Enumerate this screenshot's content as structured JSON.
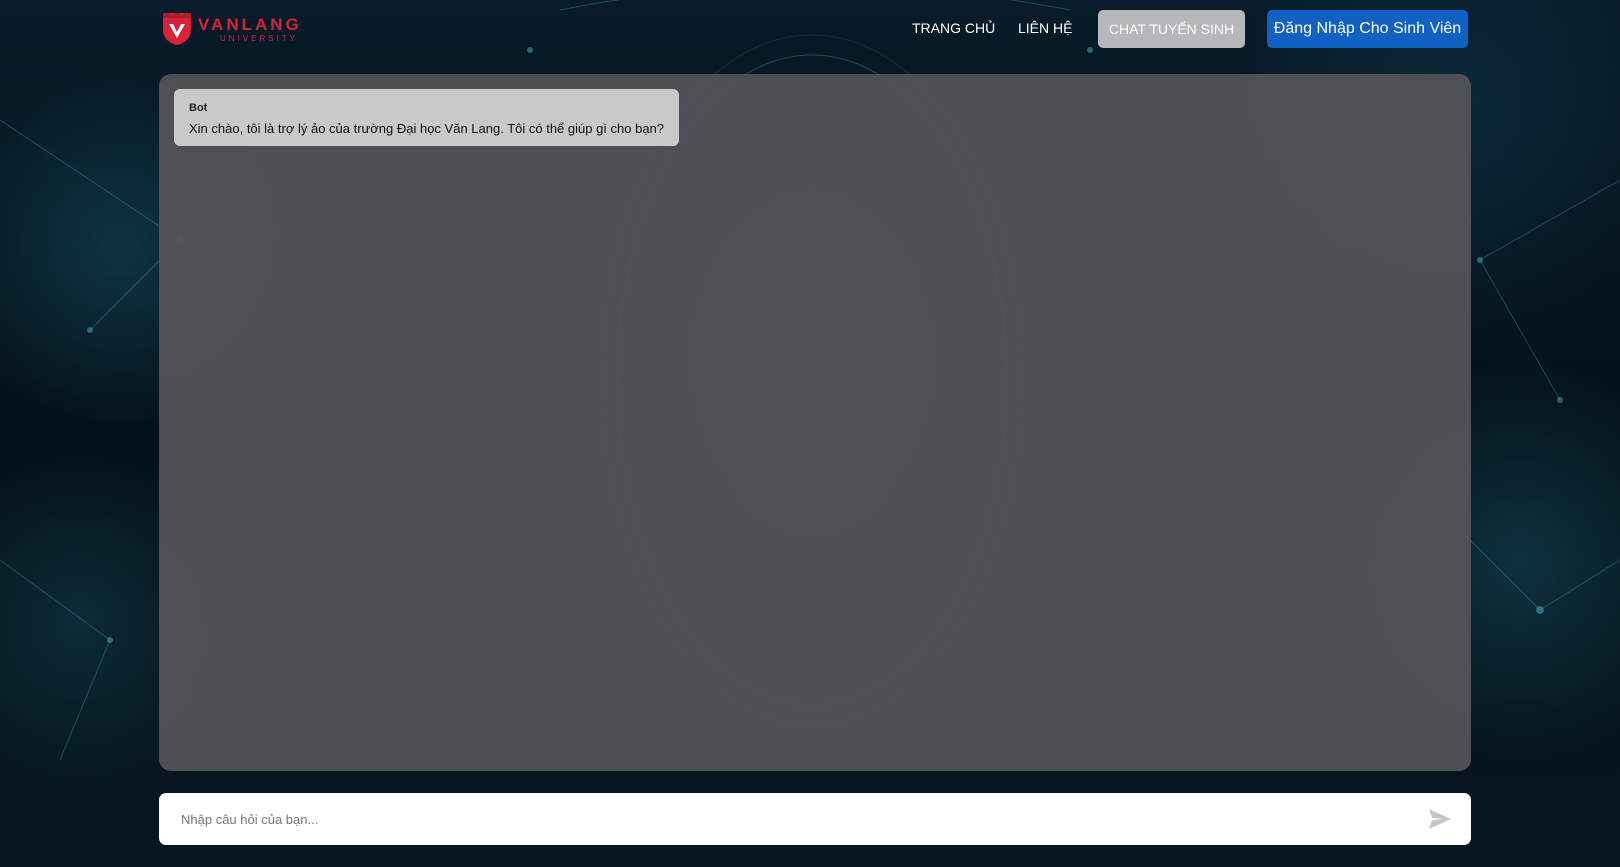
{
  "brand": {
    "name": "VANLANG",
    "sub": "UNIVERSITY",
    "color": "#d7223a"
  },
  "nav": {
    "home": "TRANG CHỦ",
    "contact": "LIÊN HỆ",
    "chat_button": "CHAT TUYỂN SINH",
    "login_button": "Đăng Nhập Cho Sinh Viên"
  },
  "chat": {
    "messages": [
      {
        "sender": "Bot",
        "text": "Xin chào, tôi là trợ lý ảo của trường Đại học Văn Lang. Tôi có thể giúp gì cho bạn?"
      }
    ]
  },
  "composer": {
    "placeholder": "Nhập câu hỏi của bạn...",
    "send_icon": "send-icon"
  },
  "colors": {
    "login_button": "#1160c4",
    "chat_button": "#b5b7b9",
    "panel": "#545456"
  }
}
